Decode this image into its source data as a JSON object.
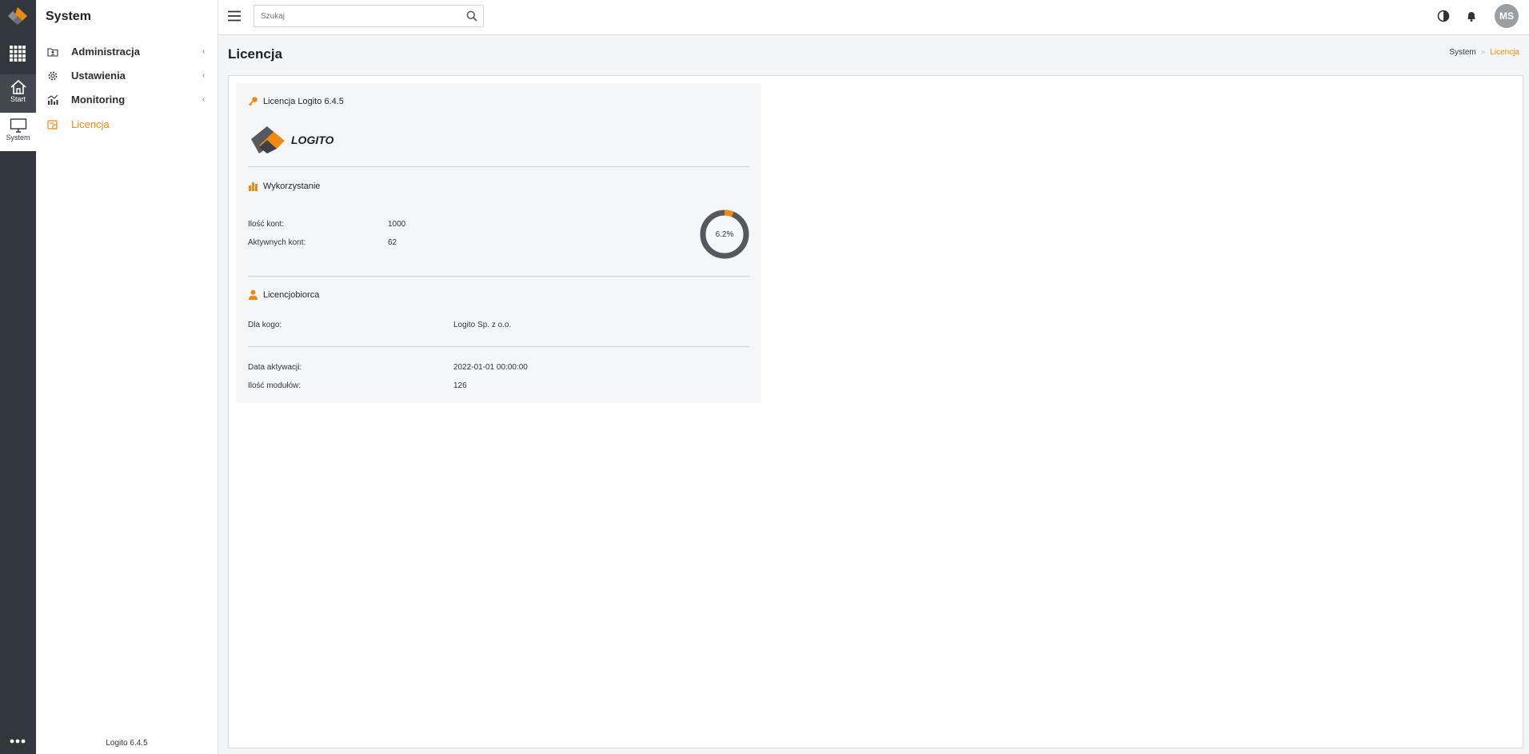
{
  "rail": {
    "items": [
      {
        "label": "Start",
        "icon": "home-icon"
      },
      {
        "label": "System",
        "icon": "monitor-icon"
      }
    ]
  },
  "sidebar": {
    "title": "System",
    "items": [
      {
        "label": "Administracja",
        "icon": "folder-user-icon",
        "has_children": true
      },
      {
        "label": "Ustawienia",
        "icon": "gear-icon",
        "has_children": true
      },
      {
        "label": "Monitoring",
        "icon": "chart-line-icon",
        "has_children": true
      },
      {
        "label": "Licencja",
        "icon": "license-icon",
        "has_children": false,
        "active": true
      }
    ],
    "version": "Logito 6.4.5"
  },
  "topbar": {
    "search_placeholder": "Szukaj",
    "avatar_initials": "MS"
  },
  "page": {
    "title": "Licencja",
    "breadcrumb": [
      "System",
      "Licencja"
    ]
  },
  "license": {
    "header": "Licencja Logito 6.4.5",
    "logo_text": "LOGITO",
    "usage": {
      "title": "Wykorzystanie",
      "accounts_label": "Ilość kont:",
      "accounts_value": "1000",
      "active_label": "Aktywnych kont:",
      "active_value": "62",
      "percent_label": "6.2%",
      "percent_value": 6.2
    },
    "licensee": {
      "title": "Licencjobiorca",
      "for_label": "Dla kogo:",
      "for_value": "Logito Sp. z o.o."
    },
    "details": {
      "activation_label": "Data aktywacji:",
      "activation_value": "2022-01-01 00:00:00",
      "modules_label": "Ilość modułów:",
      "modules_value": "126"
    }
  },
  "colors": {
    "accent": "#f0890f",
    "rail_bg": "#32363d",
    "donut_track": "#55585d"
  }
}
